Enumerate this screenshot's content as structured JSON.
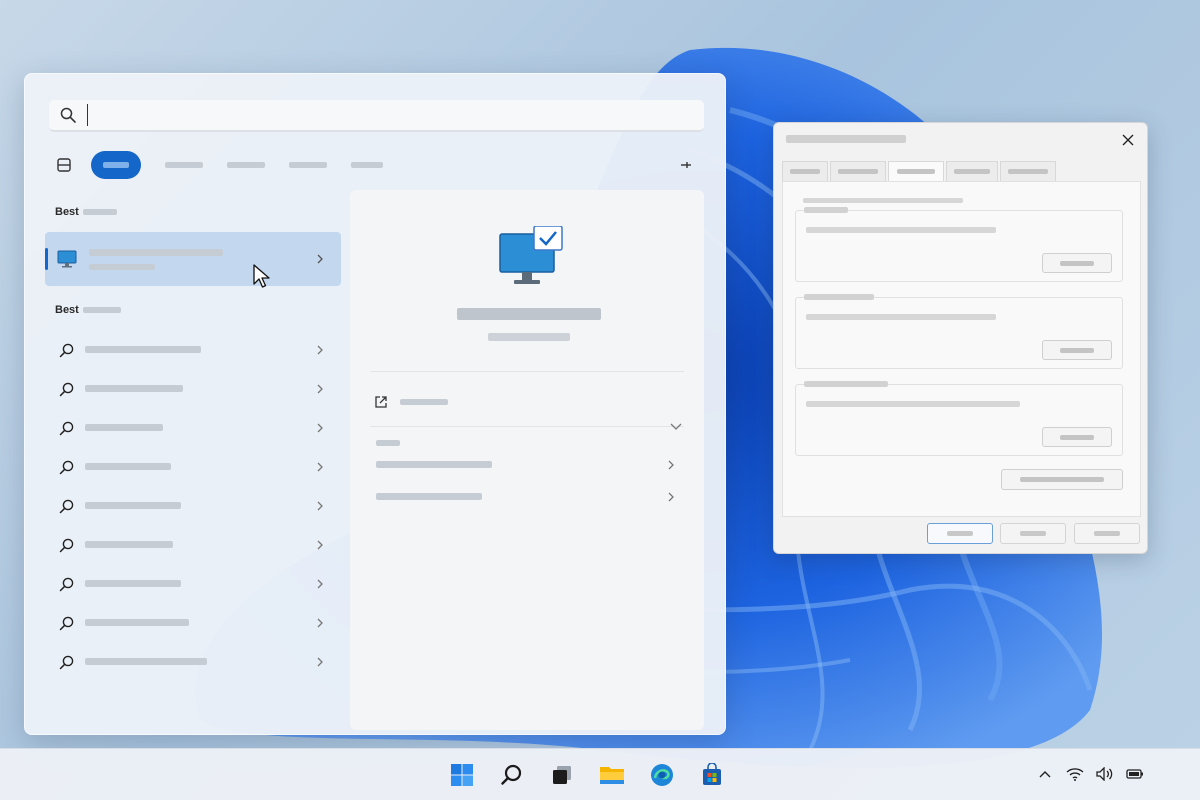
{
  "search": {
    "value": "",
    "placeholder": ""
  },
  "filters": {
    "active": "All",
    "icons": [
      "apps-icon",
      "more-icon"
    ]
  },
  "sections": {
    "best_match_label": "Best",
    "more_results_label": "Best"
  },
  "best_match": {
    "icon": "system-properties-icon"
  },
  "results": {
    "count": 9,
    "icon": "search-icon"
  },
  "preview": {
    "icon": "system-properties-icon",
    "open_icon": "open-external-icon"
  },
  "dialog": {
    "close_icon": "close-icon",
    "tab_count": 5
  },
  "taskbar": {
    "apps": [
      "start-icon",
      "search-icon",
      "task-view-icon",
      "file-explorer-icon",
      "edge-icon",
      "store-icon"
    ],
    "tray": [
      "chevron-up-icon",
      "wifi-icon",
      "volume-icon",
      "battery-icon"
    ]
  },
  "colors": {
    "accent": "#1467c9",
    "selected_row": "#c3d8ef",
    "wallpaper_blue": "#1a5fd6"
  }
}
